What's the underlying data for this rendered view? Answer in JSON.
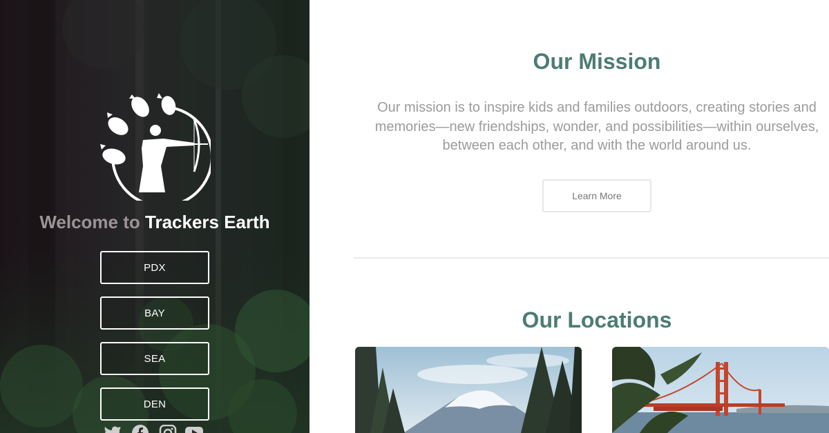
{
  "hero": {
    "welcome_prefix": "Welcome to",
    "welcome_brand": "Trackers Earth",
    "locations": [
      {
        "label": "PDX"
      },
      {
        "label": "BAY"
      },
      {
        "label": "SEA"
      },
      {
        "label": "DEN"
      }
    ],
    "social": [
      "twitter-icon",
      "facebook-icon",
      "instagram-icon",
      "youtube-icon"
    ]
  },
  "mission": {
    "title": "Our Mission",
    "text": "Our mission is to inspire kids and families outdoors, creating stories and memories—new friendships, wonder, and possibilities—within ourselves, between each other, and with the world around us.",
    "button_label": "Learn More"
  },
  "locations": {
    "title": "Our Locations",
    "cards": [
      "mountain-photo",
      "golden-gate-bridge-photo"
    ]
  },
  "colors": {
    "accent": "#4c7c74",
    "muted_text": "#9b9b9b",
    "hero_bg": "#1e1a1d"
  }
}
